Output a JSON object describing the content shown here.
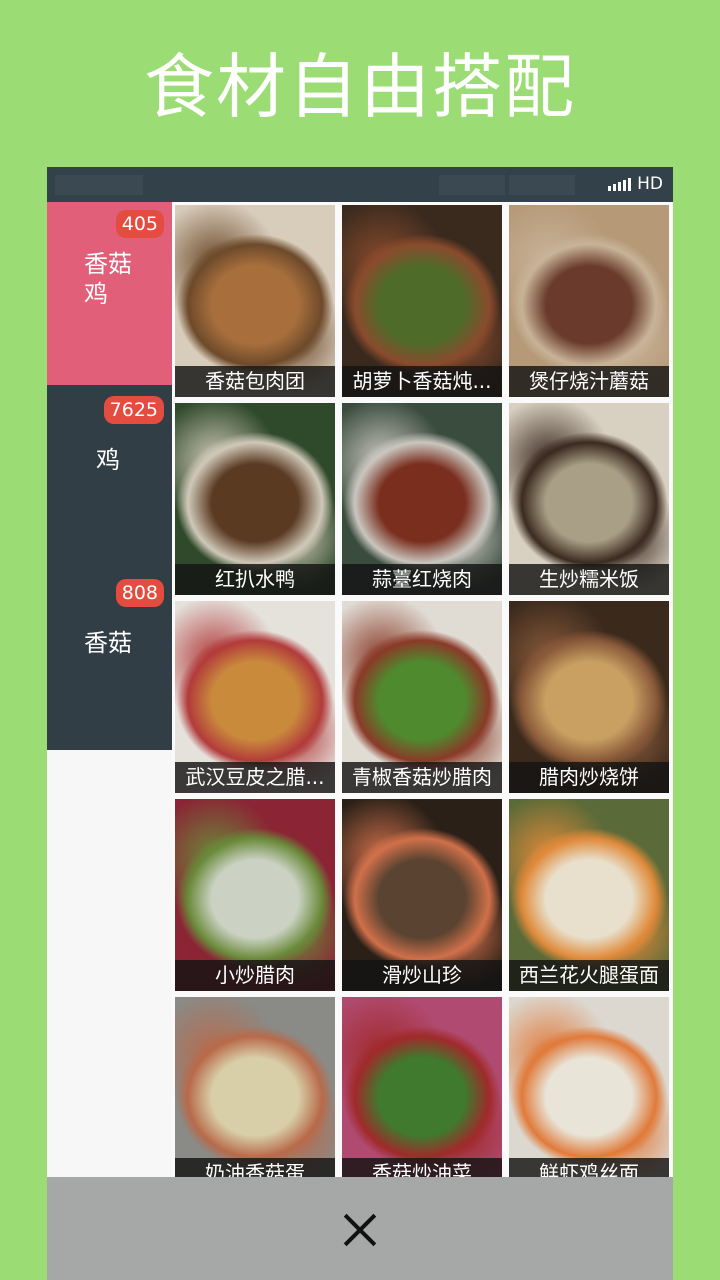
{
  "headline": "食材自由搭配",
  "status_bar": {
    "network": "HD",
    "signal_icon": "signal-bars-icon"
  },
  "categories": [
    {
      "name": "香菇\n鸡",
      "count": "405",
      "active": true
    },
    {
      "name": "鸡",
      "count": "7625",
      "active": false
    },
    {
      "name": "香菇",
      "count": "808",
      "active": false
    }
  ],
  "recipes": [
    {
      "title": "香菇包肉团",
      "palette": [
        "#d8cdbb",
        "#a86f3c",
        "#6d4a2b"
      ]
    },
    {
      "title": "胡萝卜香菇炖...",
      "palette": [
        "#3a2a1e",
        "#4f6b2a",
        "#8a4b2c"
      ]
    },
    {
      "title": "煲仔烧汁蘑菇",
      "palette": [
        "#b69a78",
        "#6a3b2c",
        "#c8b398"
      ]
    },
    {
      "title": "红扒水鸭",
      "palette": [
        "#2f4a2a",
        "#5b3a22",
        "#cfc8b8"
      ]
    },
    {
      "title": "蒜薹红烧肉",
      "palette": [
        "#3a4c3e",
        "#7a2e1e",
        "#c9c6bf"
      ]
    },
    {
      "title": "生炒糯米饭",
      "palette": [
        "#d8d0c0",
        "#a99f86",
        "#3b2a20"
      ]
    },
    {
      "title": "武汉豆皮之腊...",
      "palette": [
        "#e5e2dc",
        "#c98a3c",
        "#b23b3b"
      ]
    },
    {
      "title": "青椒香菇炒腊肉",
      "palette": [
        "#e0dcd4",
        "#4f8a2e",
        "#8a3a28"
      ]
    },
    {
      "title": "腊肉炒烧饼",
      "palette": [
        "#3b2a1c",
        "#c9a062",
        "#8a5a3a"
      ]
    },
    {
      "title": "小炒腊肉",
      "palette": [
        "#8b2434",
        "#cbd2c3",
        "#6a8a3a"
      ]
    },
    {
      "title": "滑炒山珍",
      "palette": [
        "#2a2018",
        "#5a4330",
        "#d0704a"
      ]
    },
    {
      "title": "西兰花火腿蛋面",
      "palette": [
        "#5a6a38",
        "#e8e0cc",
        "#e08a3a"
      ]
    },
    {
      "title": "奶油香菇蛋",
      "palette": [
        "#8a8a86",
        "#d8cfa8",
        "#b86a4a"
      ]
    },
    {
      "title": "香菇炒油菜",
      "palette": [
        "#b04a70",
        "#3f7a2e",
        "#a02a2a"
      ]
    },
    {
      "title": "鲜虾鸡丝面",
      "palette": [
        "#dcd8d0",
        "#e8e4d8",
        "#e07a3a"
      ]
    }
  ],
  "close_icon": "close-icon"
}
